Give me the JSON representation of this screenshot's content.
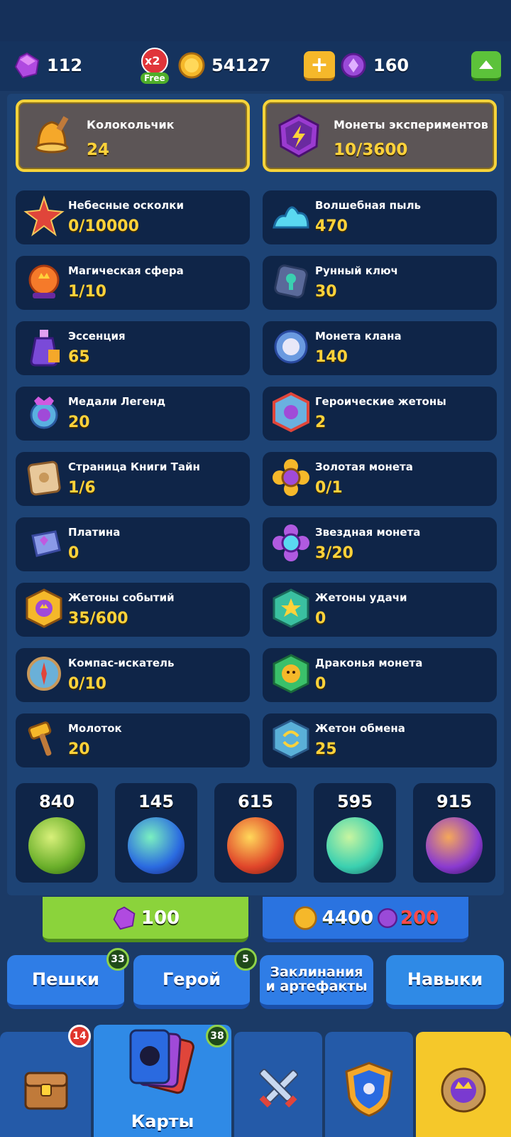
{
  "topbar": {
    "gems": "112",
    "x2_label": "x2",
    "free_label": "Free",
    "coins": "54127",
    "purple": "160"
  },
  "featured": [
    {
      "title": "Колокольчик",
      "value": "24"
    },
    {
      "title": "Монеты экспериментов",
      "value": "10/3600"
    }
  ],
  "resources_left": [
    {
      "title": "Небесные осколки",
      "value": "0/10000"
    },
    {
      "title": "Магическая сфера",
      "value": "1/10"
    },
    {
      "title": "Эссенция",
      "value": "65"
    },
    {
      "title": "Медали Легенд",
      "value": "20"
    },
    {
      "title": "Страница Книги Тайн",
      "value": "1/6"
    },
    {
      "title": "Платина",
      "value": "0"
    },
    {
      "title": "Жетоны событий",
      "value": "35/600"
    },
    {
      "title": "Компас-искатель",
      "value": "0/10"
    },
    {
      "title": "Молоток",
      "value": "20"
    }
  ],
  "resources_right": [
    {
      "title": "Волшебная пыль",
      "value": "470"
    },
    {
      "title": "Рунный ключ",
      "value": "30"
    },
    {
      "title": "Монета клана",
      "value": "140"
    },
    {
      "title": "Героические жетоны",
      "value": "2"
    },
    {
      "title": "Золотая монета",
      "value": "0/1"
    },
    {
      "title": "Звездная монета",
      "value": "3/20"
    },
    {
      "title": "Жетоны удачи",
      "value": "0"
    },
    {
      "title": "Драконья монета",
      "value": "0"
    },
    {
      "title": "Жетон обмена",
      "value": "25"
    }
  ],
  "orbs": [
    {
      "count": "840",
      "color": "#8fcf3a"
    },
    {
      "count": "145",
      "color": "#3aa0e0"
    },
    {
      "count": "615",
      "color": "#e05a2a"
    },
    {
      "count": "595",
      "color": "#3ad0b0"
    },
    {
      "count": "915",
      "color": "#8a3ad0"
    }
  ],
  "buy": {
    "gem_price": "100",
    "coin_price": "4400",
    "purple_price": "200"
  },
  "categories": [
    {
      "label": "Пешки",
      "badge": "33"
    },
    {
      "label": "Герой",
      "badge": "5"
    },
    {
      "label": "Заклинания\nи артефакты",
      "badge": ""
    },
    {
      "label": "Навыки",
      "badge": ""
    }
  ],
  "nav": {
    "chest_badge": "14",
    "cards_badge": "38",
    "cards_label": "Карты"
  },
  "colors": {
    "accent": "#ffd23a",
    "card_bg": "#0f2548",
    "panel_bg": "#1d4375"
  }
}
